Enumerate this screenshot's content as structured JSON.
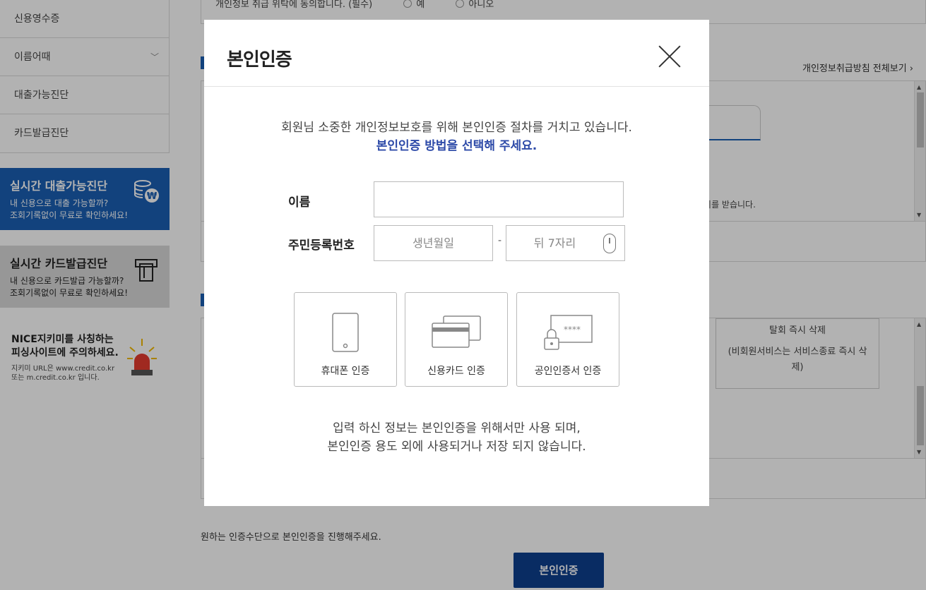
{
  "sidebar": {
    "items": [
      {
        "label": "신용영수증"
      },
      {
        "label": "이름어때"
      },
      {
        "label": "대출가능진단"
      },
      {
        "label": "카드발급진단"
      }
    ],
    "banner_loan": {
      "title": "실시간 대출가능진단",
      "line1": "내 신용으로 대출 가능할까?",
      "line2": "조회기록없이 무료로 확인하세요!"
    },
    "banner_card": {
      "title": "실시간 카드발급진단",
      "line1": "내 신용으로 카드발급 가능할까?",
      "line2": "조회기록없이 무료로 확인하세요!"
    },
    "warning": {
      "line1": "NICE지키미를 사칭하는",
      "line2": "피싱사이트에 주의하세요.",
      "sub1": "지키미 URL은 www.credit.co.kr",
      "sub2": "또는 m.credit.co.kr 입니다."
    }
  },
  "background": {
    "consent_text": "개인정보 취급 위탁에 동의합니다. (필수)",
    "consent_yes": "예",
    "consent_no": "아니오",
    "policy_link": "개인정보취급방침 전체보기",
    "partial_text": "동의를 받습니다.",
    "delete_title": "탈회 즉시 삭제",
    "delete_desc": "(비회원서비스는 서비스종료 즉시 삭제)",
    "bottom_note": "원하는 인증수단으로 본인인증을 진행해주세요.",
    "bottom_button": "본인인증"
  },
  "modal": {
    "title": "본인인증",
    "intro_line1": "회원님 소중한 개인정보보호를 위해 본인인증 절차를 거치고 있습니다.",
    "intro_line2": "본인인증 방법을 선택해 주세요.",
    "name_label": "이름",
    "name_value": "",
    "rrn_label": "주민등록번호",
    "rrn_front_placeholder": "생년월일",
    "rrn_dash": "-",
    "rrn_back_placeholder": "뒤 7자리",
    "methods": [
      {
        "label": "휴대폰 인증",
        "icon": "mobile-phone-icon"
      },
      {
        "label": "신용카드 인증",
        "icon": "credit-card-icon"
      },
      {
        "label": "공인인증서 인증",
        "icon": "certificate-lock-icon"
      }
    ],
    "footer_line1": "입력 하신 정보는 본인인증을 위해서만 사용 되며,",
    "footer_line2": "본인인증 용도 외에 사용되거나 저장 되지 않습니다.",
    "certificate_mask": "****"
  },
  "colors": {
    "accent": "#2d4aa8",
    "primary_button": "#0d3f8f",
    "banner_blue": "#1a5fb4"
  }
}
